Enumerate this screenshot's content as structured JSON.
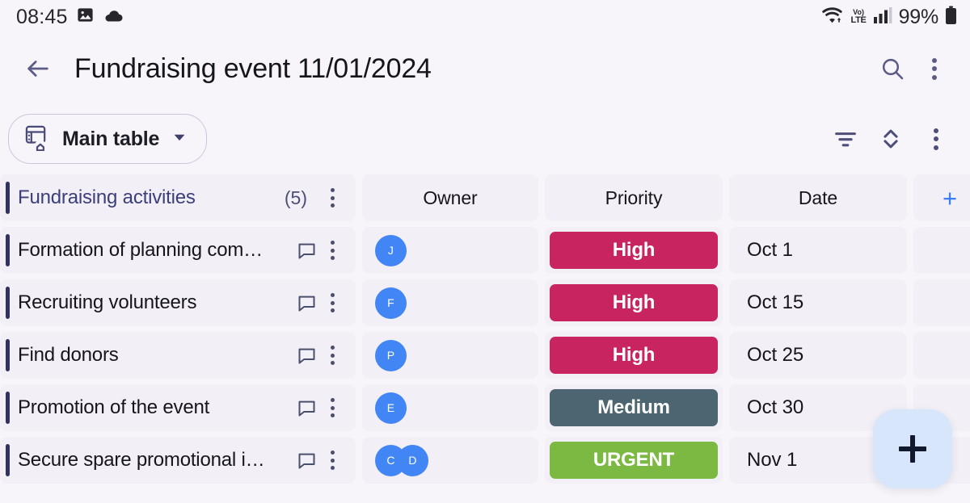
{
  "status_bar": {
    "time": "08:45",
    "left_icons": [
      "image-icon",
      "cloud-icon"
    ],
    "right_icons": [
      "wifi-icon",
      "volte-icon",
      "signal-bars-icon"
    ],
    "volte_top": "Vo)",
    "volte_bottom": "LTE",
    "battery_text": "99%"
  },
  "header": {
    "back_label": "back-arrow",
    "title": "Fundraising event 11/01/2024",
    "search_label": "search",
    "overflow_label": "more options"
  },
  "toolbar": {
    "board_label": "Main table",
    "board_icon": "table-home-icon",
    "dropdown_icon": "chevron-down-icon",
    "filter_label": "filter",
    "sort_label": "sort",
    "overflow_label": "more options"
  },
  "table": {
    "group": {
      "name": "Fundraising activities",
      "count": "(5)"
    },
    "columns": [
      {
        "label": "Owner"
      },
      {
        "label": "Priority"
      },
      {
        "label": "Date"
      }
    ],
    "add_column_label": "+",
    "rows": [
      {
        "name": "Formation of planning com…",
        "owners": [
          {
            "initial": "J"
          }
        ],
        "priority": {
          "label": "High",
          "color": "#c8245f"
        },
        "date": "Oct 1"
      },
      {
        "name": "Recruiting volunteers",
        "owners": [
          {
            "initial": "F"
          }
        ],
        "priority": {
          "label": "High",
          "color": "#c8245f"
        },
        "date": "Oct 15"
      },
      {
        "name": "Find donors",
        "owners": [
          {
            "initial": "P"
          }
        ],
        "priority": {
          "label": "High",
          "color": "#c8245f"
        },
        "date": "Oct 25"
      },
      {
        "name": "Promotion of the event",
        "owners": [
          {
            "initial": "E"
          }
        ],
        "priority": {
          "label": "Medium",
          "color": "#4d6570"
        },
        "date": "Oct 30"
      },
      {
        "name": "Secure spare promotional i…",
        "owners": [
          {
            "initial": "C"
          },
          {
            "initial": "D"
          }
        ],
        "priority": {
          "label": "URGENT",
          "color": "#7cb943"
        },
        "date": "Nov 1"
      }
    ]
  },
  "fab": {
    "label": "+"
  },
  "colors": {
    "background": "#f7f5fa",
    "cell": "#f2eff6",
    "accent_bar": "#31325f",
    "icon": "#4b4f6e",
    "avatar": "#4285f4",
    "add_column": "#3d7df5",
    "fab_bg": "#d8e6fb"
  }
}
